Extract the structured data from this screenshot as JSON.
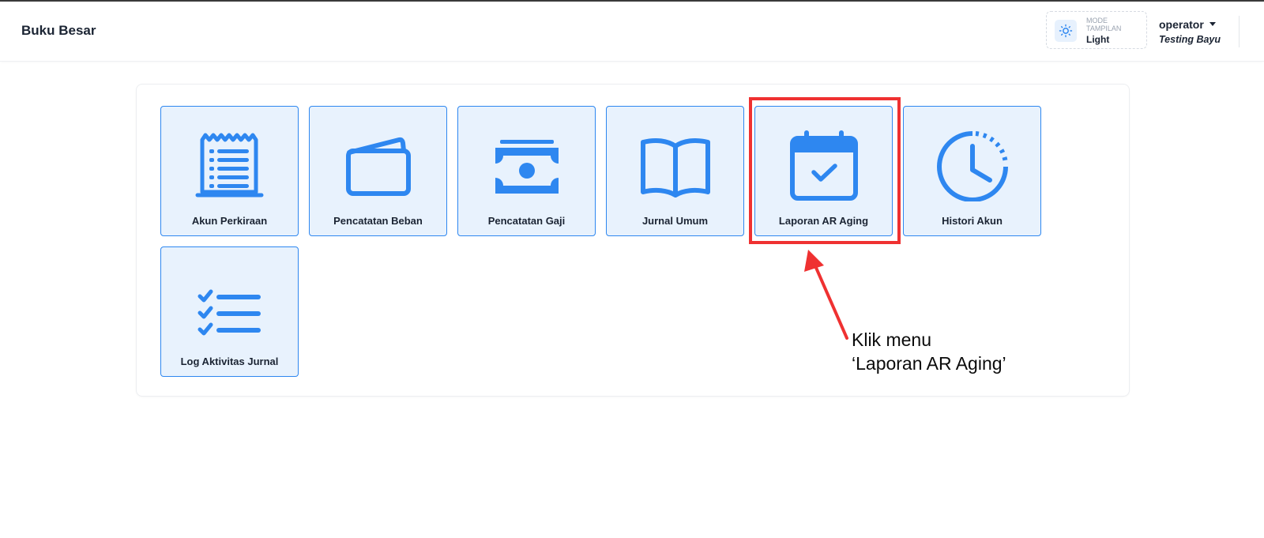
{
  "header": {
    "title": "Buku Besar",
    "mode": {
      "label": "MODE TAMPILAN",
      "value": "Light",
      "icon": "sun-icon"
    },
    "user": {
      "name": "operator",
      "subtitle": "Testing Bayu"
    }
  },
  "menu": [
    {
      "label": "Akun Perkiraan",
      "icon": "receipt-icon"
    },
    {
      "label": "Pencatatan Beban",
      "icon": "wallet-icon"
    },
    {
      "label": "Pencatatan Gaji",
      "icon": "cash-icon"
    },
    {
      "label": "Jurnal Umum",
      "icon": "book-icon"
    },
    {
      "label": "Laporan AR Aging",
      "icon": "calendar-check-icon"
    },
    {
      "label": "Histori Akun",
      "icon": "clock-history-icon"
    },
    {
      "label": "Log Aktivitas Jurnal",
      "icon": "checklist-icon"
    }
  ],
  "annotation": {
    "line1": "Klik menu",
    "line2": "‘Laporan AR Aging’",
    "color": "#ef3131"
  },
  "colors": {
    "accent": "#2e87f0",
    "tile_bg": "#e8f2fd",
    "text": "#1b2433"
  }
}
